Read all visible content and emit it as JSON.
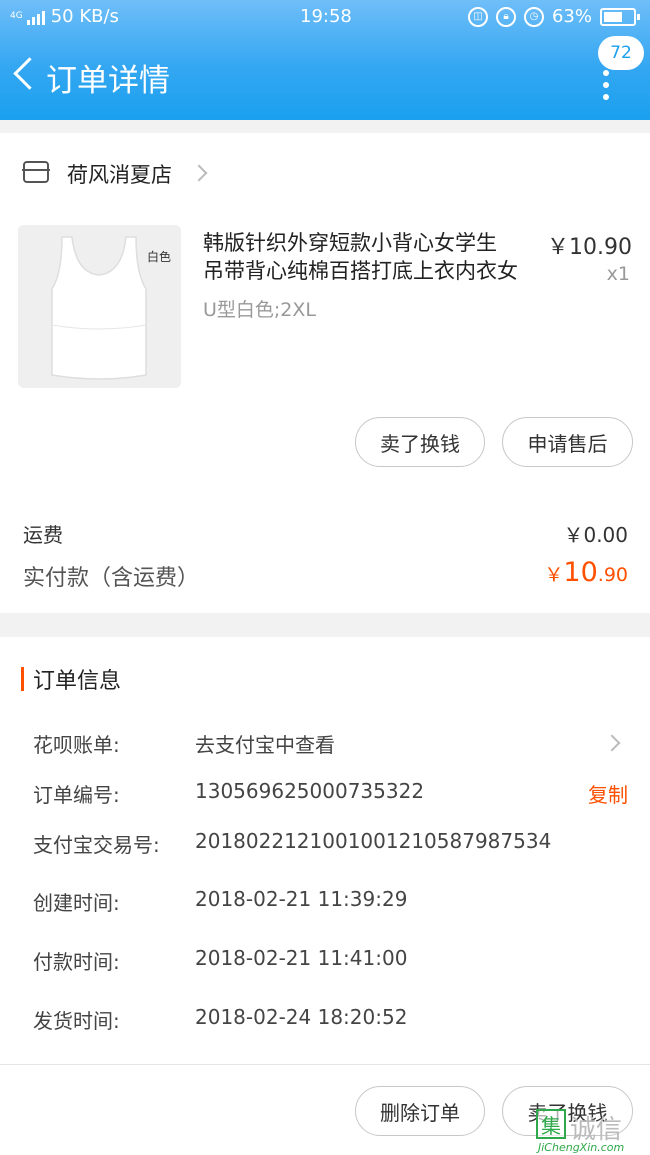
{
  "status_bar": {
    "network": "4G",
    "speed": "50 KB/s",
    "time": "19:58",
    "battery": "63%",
    "battery_level": 0.63
  },
  "header": {
    "title": "订单详情",
    "badge_count": "72"
  },
  "store": {
    "name": "荷风消夏店"
  },
  "item": {
    "thumb_label": "白色",
    "title_line1": "韩版针织外穿短款小背心女学生",
    "title_line2": "吊带背心纯棉百搭打底上衣内衣女",
    "sku": "U型白色;2XL",
    "price": "￥10.90",
    "qty": "x1",
    "sell_button": "卖了换钱",
    "after_sale_button": "申请售后"
  },
  "summary": {
    "shipping_label": "运费",
    "shipping_value": "￥0.00",
    "paid_label": "实付款（含运费）",
    "paid_currency": "￥",
    "paid_int": "10",
    "paid_dec": ".90"
  },
  "order_info": {
    "title": "订单信息",
    "rows": [
      {
        "key": "花呗账单:",
        "value": "去支付宝中查看"
      },
      {
        "key": "订单编号:",
        "value": "130569625000735322"
      },
      {
        "key": "支付宝交易号:",
        "value": "2018022121001001210587987534"
      },
      {
        "key": "创建时间:",
        "value": "2018-02-21 11:39:29"
      },
      {
        "key": "付款时间:",
        "value": "2018-02-21 11:41:00"
      },
      {
        "key": "发货时间:",
        "value": "2018-02-24 18:20:52"
      }
    ],
    "copy_label": "复制"
  },
  "footer": {
    "delete_button": "删除订单",
    "sell_button": "卖了换钱"
  },
  "watermark": {
    "char": "集",
    "text": "诚信",
    "url": "JiChengXin.com"
  },
  "colors": {
    "header_blue": "#1aa0ee",
    "accent_orange": "#ff5000"
  }
}
